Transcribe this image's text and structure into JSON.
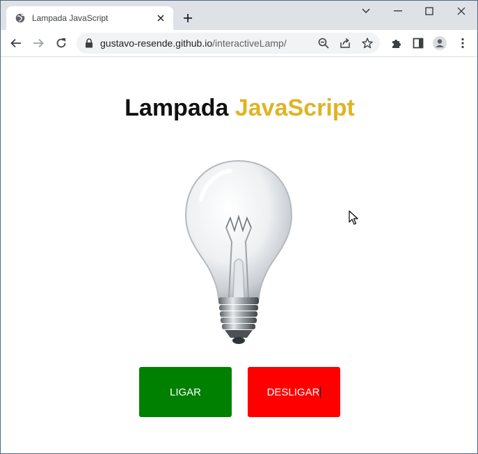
{
  "browser": {
    "tab": {
      "title": "Lampada JavaScript",
      "favicon": "globe-icon",
      "close_icon": "close-icon"
    },
    "new_tab_icon": "plus-icon",
    "window_controls": [
      "chevron-down-icon",
      "minimize-icon",
      "maximize-icon",
      "close-icon"
    ],
    "nav": [
      "back-arrow-icon",
      "forward-arrow-icon",
      "reload-icon"
    ],
    "address": {
      "host": "gustavo-resende.github.io",
      "path": "/interactiveLamp/",
      "secure_icon": "lock-icon"
    },
    "omnibox_icons": [
      "zoom-icon",
      "share-icon",
      "star-icon"
    ],
    "toolbar_icons": [
      "extensions-icon",
      "side-panel-icon",
      "profile-icon",
      "menu-icon"
    ]
  },
  "page": {
    "title_part1": "Lampada ",
    "title_part2": "JavaScript",
    "accent_color": "#e0b323",
    "lamp_state": "off",
    "buttons": {
      "on_label": "LIGAR",
      "on_color": "#008000",
      "off_label": "DESLIGAR",
      "off_color": "#ff0000"
    }
  }
}
